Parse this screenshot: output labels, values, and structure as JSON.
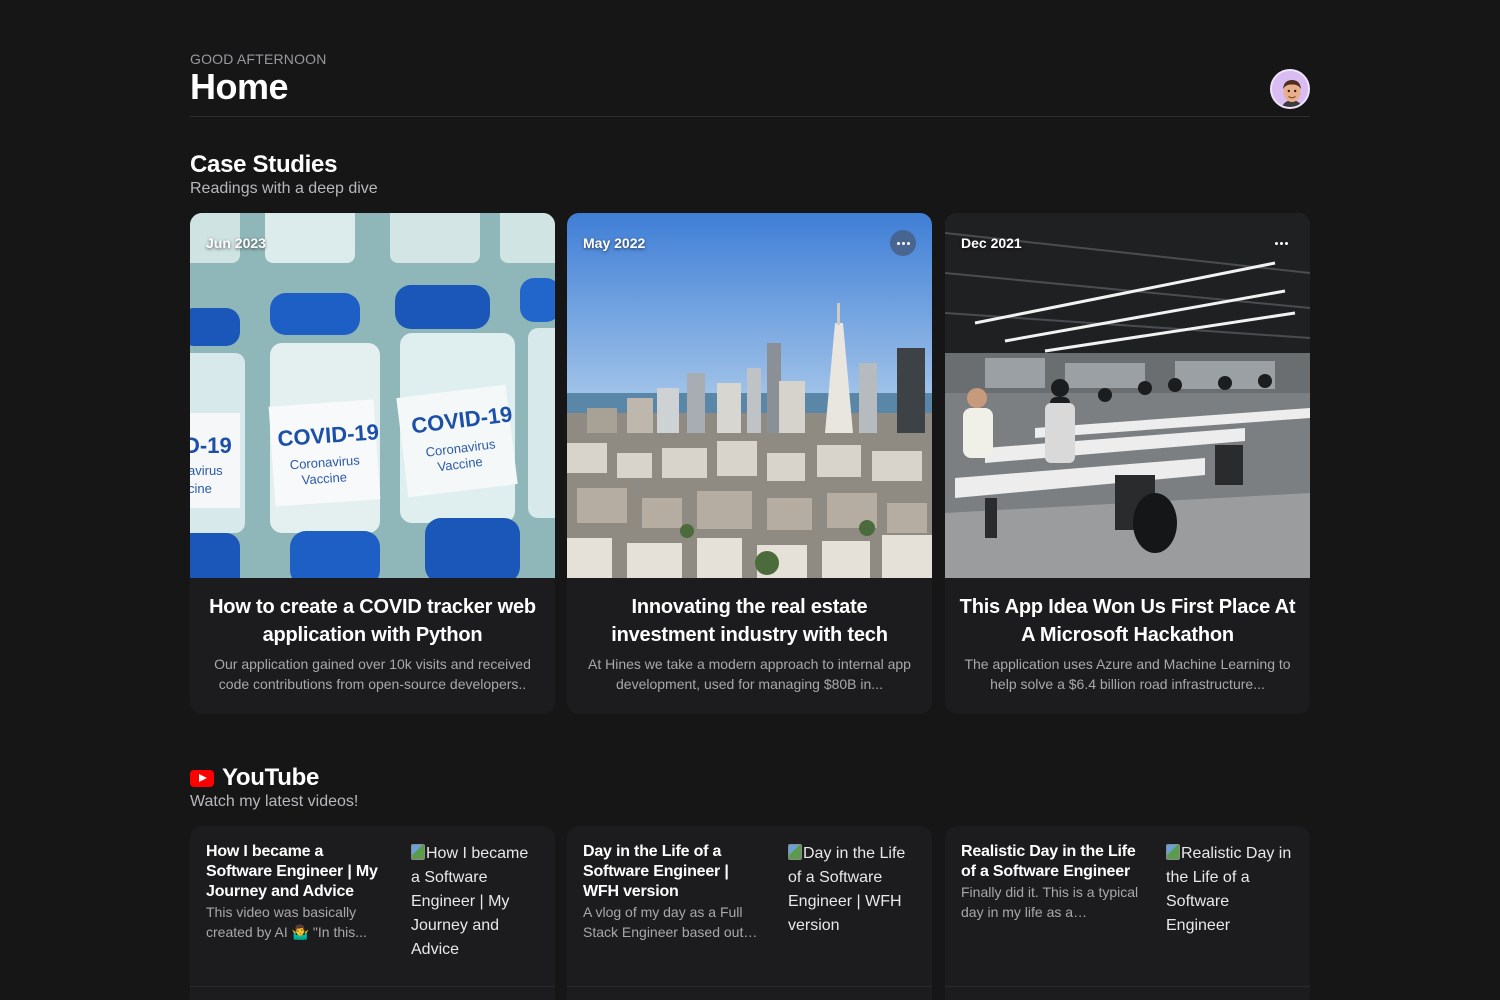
{
  "header": {
    "greeting": "GOOD AFTERNOON",
    "title": "Home",
    "avatar_icon": "memoji-avatar-icon"
  },
  "case_studies": {
    "title": "Case Studies",
    "subtitle": "Readings with a deep dive",
    "cards": [
      {
        "date": "Jun 2023",
        "title": "How to create a COVID tracker web application with Python",
        "description": "Our application gained over 10k visits and received code contributions from open-source developers..",
        "image_icon": "covid-vaccine-vials-photo",
        "image_labels": [
          "COVID-19",
          "Coronavirus",
          "Vaccine"
        ]
      },
      {
        "date": "May 2022",
        "title": "Innovating the real estate investment industry with tech",
        "description": "At Hines we take a modern approach to internal app development, used for managing $80B in...",
        "image_icon": "city-skyline-photo"
      },
      {
        "date": "Dec 2021",
        "title": "This App Idea Won Us First Place At A Microsoft Hackathon",
        "description": "The application uses Azure and Machine Learning to help solve a $6.4 billion road infrastructure...",
        "image_icon": "office-hackathon-photo"
      }
    ]
  },
  "youtube": {
    "title": "YouTube",
    "subtitle": "Watch my latest videos!",
    "icon": "youtube-logo-icon",
    "accent": "#ff0000",
    "videos": [
      {
        "title": "How I became a Software Engineer | My Journey and Advice",
        "description": "This video was basically created by AI 🤷‍♂️ \"In this...",
        "thumb_alt": "How I became a Software Engineer | My Journey and Advice"
      },
      {
        "title": "Day in the Life of a Software Engineer | WFH version",
        "description": "A vlog of my day as a Full Stack Engineer based out o...",
        "thumb_alt": "Day in the Life of a Software Engineer | WFH version"
      },
      {
        "title": "Realistic Day in the Life of a Software Engineer",
        "description": "Finally did it. This is a typical day in my life as a software...",
        "thumb_alt": "Realistic Day in the Life of a Software Engineer"
      }
    ]
  }
}
